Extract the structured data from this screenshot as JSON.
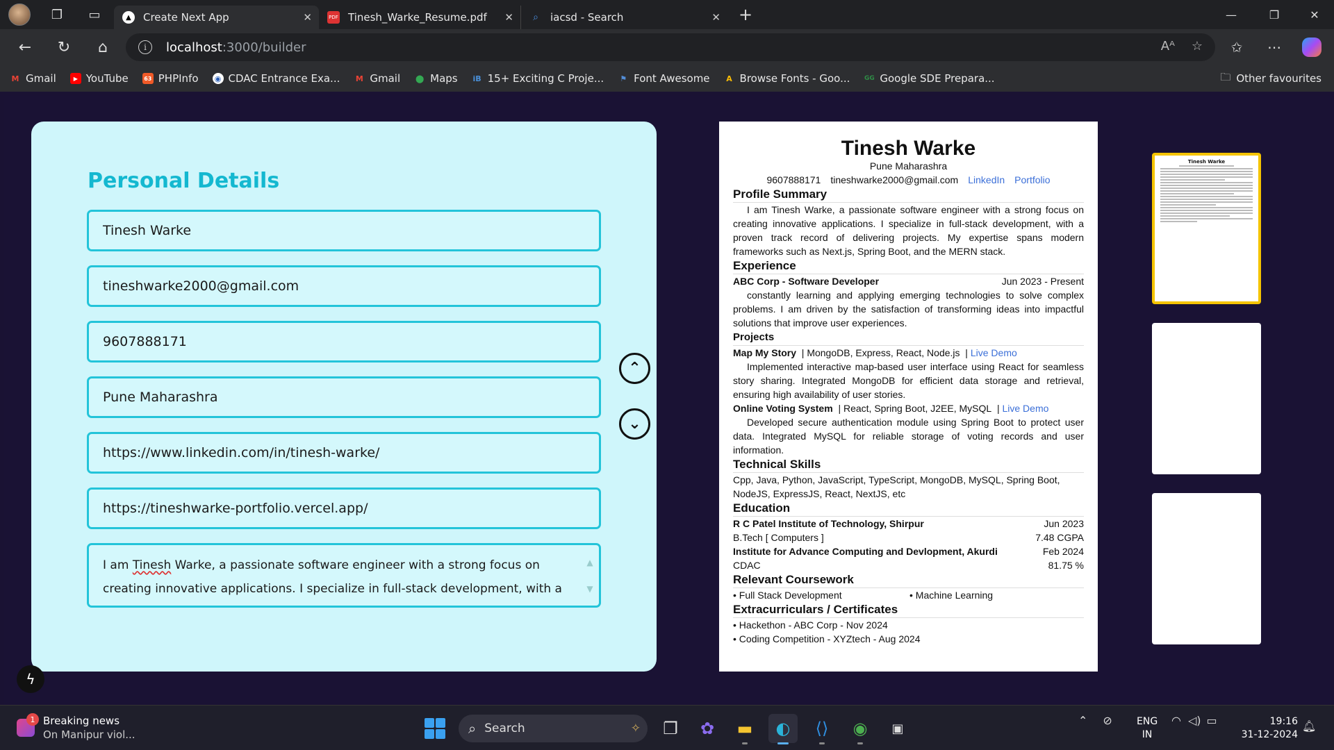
{
  "browser": {
    "tabs": [
      {
        "label": "Create Next App",
        "active": true
      },
      {
        "label": "Tinesh_Warke_Resume.pdf",
        "active": false
      },
      {
        "label": "iacsd - Search",
        "active": false
      }
    ],
    "url_host": "localhost",
    "url_path": ":3000/builder",
    "bookmarks": [
      {
        "label": "Gmail",
        "icon": "gmail-icon",
        "color": "#ea4335"
      },
      {
        "label": "YouTube",
        "icon": "youtube-icon",
        "color": "#ff0000"
      },
      {
        "label": "PHPInfo",
        "icon": "phpinfo-icon",
        "color": "#f05a28"
      },
      {
        "label": "CDAC Entrance Exa...",
        "icon": "cdac-icon",
        "color": "#3b82f6"
      },
      {
        "label": "Gmail",
        "icon": "gmail-icon",
        "color": "#ea4335"
      },
      {
        "label": "Maps",
        "icon": "maps-icon",
        "color": "#34a853"
      },
      {
        "label": "15+ Exciting C Proje...",
        "icon": "ib-icon",
        "color": "#4a90d9"
      },
      {
        "label": "Font Awesome",
        "icon": "flag-icon",
        "color": "#538dd7"
      },
      {
        "label": "Browse Fonts - Goo...",
        "icon": "google-fonts-icon",
        "color": "#fbbc05"
      },
      {
        "label": "Google SDE Prepara...",
        "icon": "gfg-icon",
        "color": "#2f8d46"
      }
    ],
    "other_favourites": "Other favourites"
  },
  "form": {
    "title": "Personal Details",
    "name": "Tinesh Warke",
    "email": "tineshwarke2000@gmail.com",
    "phone": "9607888171",
    "location": "Pune Maharashra",
    "linkedin": "https://www.linkedin.com/in/tinesh-warke/",
    "portfolio": "https://tineshwarke-portfolio.vercel.app/",
    "summary_pre": "I am ",
    "summary_name": "Tinesh",
    "summary_post": " Warke, a passionate software engineer with a strong focus on creating innovative applications. I specialize in full-stack development, with a proven track"
  },
  "resume": {
    "name": "Tinesh Warke",
    "location": "Pune Maharashra",
    "phone": "9607888171",
    "email": "tineshwarke2000@gmail.com",
    "linkedin": "LinkedIn",
    "portfolio": "Portfolio",
    "profile_heading": "Profile Summary",
    "profile_text": "I am Tinesh Warke, a passionate software engineer with a strong focus on creating innovative applications. I specialize in full-stack development, with a proven track record of delivering projects. My expertise spans modern frameworks such as Next.js, Spring Boot, and the MERN stack.",
    "experience_heading": "Experience",
    "exp_title": "ABC Corp - Software Developer",
    "exp_date": "Jun 2023 - Present",
    "exp_text": "constantly learning and applying emerging technologies to solve complex problems. I am driven by the satisfaction of transforming ideas into impactful solutions that improve user experiences.",
    "projects_heading": "Projects",
    "proj1_title": "Map My Story",
    "proj1_stack": "| MongoDB, Express, React, Node.js",
    "proj1_link": "Live Demo",
    "proj1_text": "Implemented interactive map-based user interface using React for seamless story sharing. Integrated MongoDB for efficient data storage and retrieval, ensuring high availability of user stories.",
    "proj2_title": "Online Voting System",
    "proj2_stack": "| React, Spring Boot, J2EE, MySQL",
    "proj2_link": "Live Demo",
    "proj2_text": "Developed secure authentication module using Spring Boot to protect user data. Integrated MySQL for reliable storage of voting records and user information.",
    "skills_heading": "Technical Skills",
    "skills_text": "Cpp, Java, Python, JavaScript, TypeScript, MongoDB, MySQL, Spring Boot, NodeJS, ExpressJS, React, NextJS, etc",
    "education_heading": "Education",
    "edu1_school": "R C Patel Institute of Technology, Shirpur",
    "edu1_date": "Jun 2023",
    "edu1_degree": "B.Tech [ Computers ]",
    "edu1_score": "7.48 CGPA",
    "edu2_school": "Institute for Advance Computing and Devlopment, Akurdi",
    "edu2_date": "Feb 2024",
    "edu2_degree": "CDAC",
    "edu2_score": "81.75 %",
    "coursework_heading": "Relevant Coursework",
    "course1": "• Full Stack Development",
    "course2": "• Machine Learning",
    "extra_heading": "Extracurriculars / Certificates",
    "extra1": "• Hackethon - ABC Corp - Nov 2024",
    "extra2": "• Coding Competition - XYZtech - Aug 2024"
  },
  "taskbar": {
    "news_badge": "1",
    "news_title": "Breaking news",
    "news_sub": "On Manipur viol...",
    "search": "Search",
    "lang1": "ENG",
    "lang2": "IN",
    "time": "19:16",
    "date": "31-12-2024"
  }
}
